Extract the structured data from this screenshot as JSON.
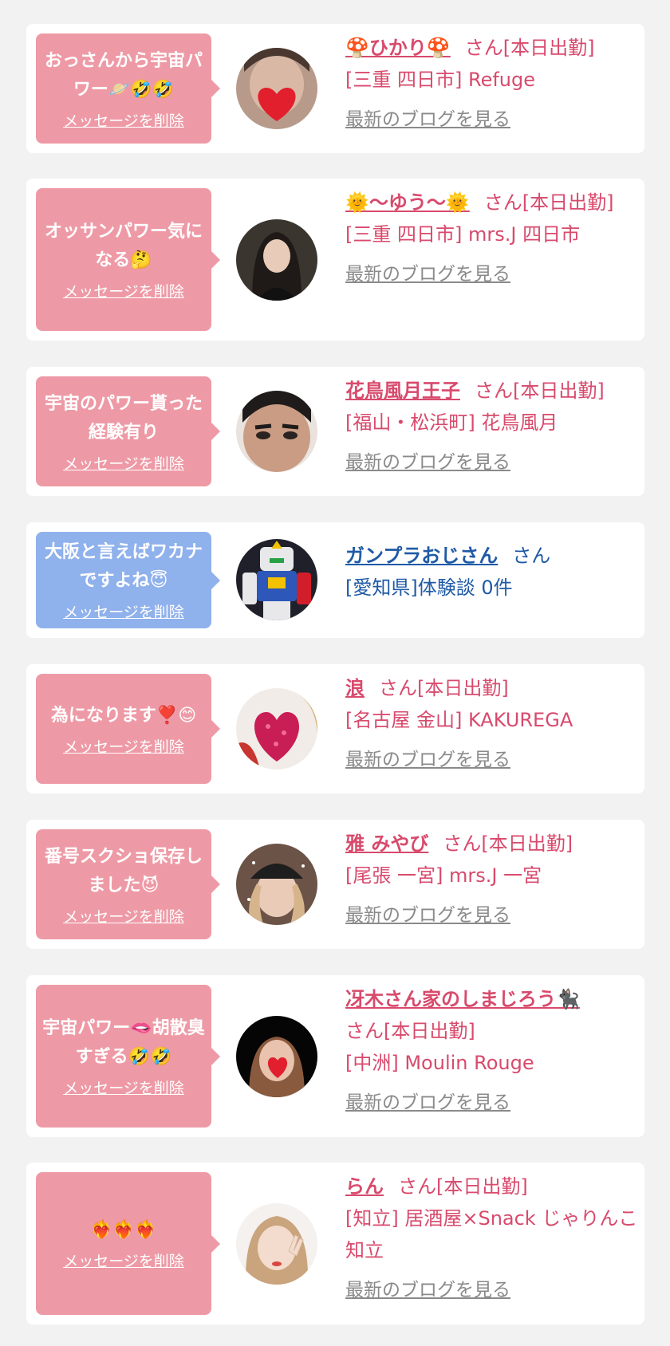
{
  "delete_label": "メッセージを削除",
  "blog_label": "最新のブログを見る",
  "colors": {
    "page_bg": "#f2f2f3",
    "pink": "#ee9aa6",
    "blue_bubble": "#8fb1ec",
    "name_pink": "#d84a6c",
    "name_blue": "#1f5aa6",
    "link_grey": "#8a8a8a"
  },
  "items": [
    {
      "message": "おっさんから宇宙パワー🪐🤣🤣",
      "name": "🍄ひかり🍄",
      "suffix": "さん[本日出勤]",
      "shop": "[三重 四日市] Refuge",
      "blog": true,
      "avatar_icon": "heart-covered-face-avatar"
    },
    {
      "message": "オッサンパワー気になる🤔",
      "name": "🌞〜ゆう〜🌞",
      "suffix": "さん[本日出勤]",
      "shop": "[三重 四日市] mrs.J 四日市",
      "blog": true,
      "avatar_icon": "woman-portrait-avatar"
    },
    {
      "message": "宇宙のパワー貰った経験有り",
      "name": "花鳥風月王子",
      "suffix": "さん[本日出勤]",
      "shop": "[福山・松浜町] 花鳥風月",
      "blog": true,
      "avatar_icon": "man-face-avatar"
    },
    {
      "message": "大阪と言えばワカナですよね😇",
      "name": "ガンプラおじさん",
      "suffix": "さん",
      "shop": "[愛知県]体験談 0件",
      "blog": false,
      "avatar_icon": "robot-model-avatar"
    },
    {
      "message": "為になります❣️😊",
      "name": "浪",
      "suffix": "さん[本日出勤]",
      "shop": "[名古屋 金山] KAKUREGA",
      "blog": true,
      "avatar_icon": "glitter-heart-avatar"
    },
    {
      "message": "番号スクショ保存しました😈",
      "name": "雅 みやび",
      "suffix": "さん[本日出勤]",
      "shop": "[尾張 一宮] mrs.J 一宮",
      "blog": true,
      "avatar_icon": "woman-cap-avatar"
    },
    {
      "message": "宇宙パワー🫦胡散臭すぎる🤣🤣",
      "name": "冴木さん家のしまじろう🐈‍⬛",
      "suffix": "さん[本日出勤]",
      "shop": "[中洲] Moulin Rouge",
      "blog": true,
      "avatar_icon": "heart-covered-face-avatar"
    },
    {
      "message": "❤️‍🔥❤️‍🔥❤️‍🔥",
      "name": "らん",
      "suffix": "さん[本日出勤]",
      "shop": "[知立] 居酒屋×Snack じゃりんこ知立",
      "blog": true,
      "avatar_icon": "woman-peace-sign-avatar"
    }
  ]
}
